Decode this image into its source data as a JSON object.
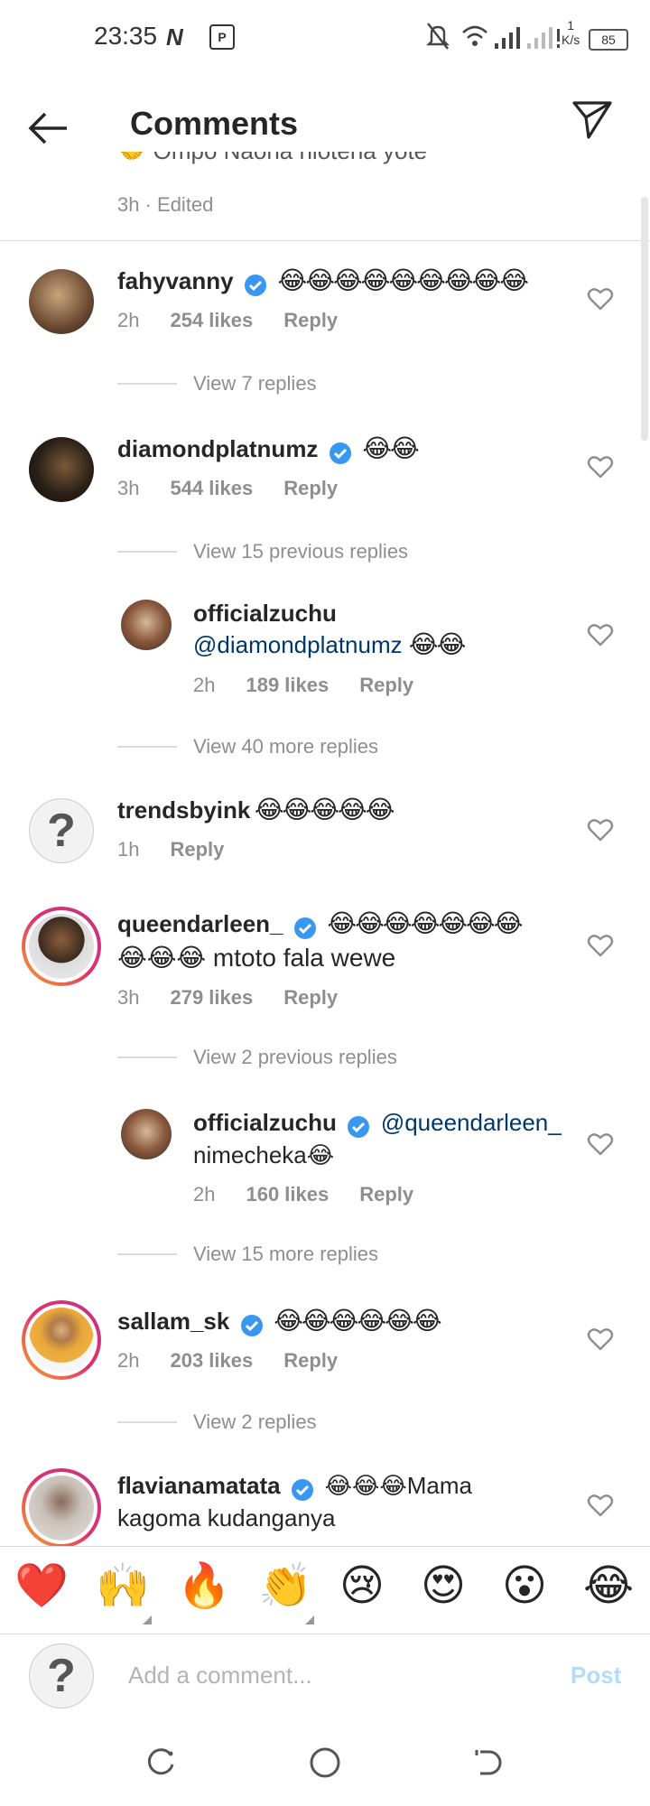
{
  "status_bar": {
    "time": "23:35",
    "n_icon": "N",
    "p_icon": "P",
    "battery": "85",
    "net_speed_top": "1",
    "net_speed_unit": "K/s"
  },
  "header": {
    "title": "Comments",
    "back_icon": "arrow-left-icon",
    "send_icon": "paper-plane-icon"
  },
  "top_partial": {
    "text_fragment": "🤝 Ompo Naona hiotena yote",
    "meta": "3h · Edited"
  },
  "comments": [
    {
      "username": "fahyvanny",
      "text": "😂😂😂😂😂😂😂😂😂",
      "time": "2h",
      "likes": "254 likes",
      "reply": "Reply",
      "view": "View 7 replies"
    },
    {
      "username": "diamondplatnumz",
      "text": "😂😂",
      "time": "3h",
      "likes": "544 likes",
      "reply": "Reply",
      "view": "View 15 previous replies"
    },
    {
      "username": "officialzuchu",
      "mention": "@diamondplatnumz",
      "text": "😂😂",
      "time": "2h",
      "likes": "189 likes",
      "reply": "Reply",
      "view": "View 40 more replies"
    },
    {
      "username": "trendsbyink",
      "text": "😂😂😂😂😂",
      "time": "1h",
      "reply": "Reply"
    },
    {
      "username": "queendarleen_",
      "text": "😂😂😂😂😂😂😂",
      "text2": "😂😂😂 mtoto fala wewe",
      "time": "3h",
      "likes": "279 likes",
      "reply": "Reply",
      "view": "View 2 previous replies"
    },
    {
      "username": "officialzuchu",
      "mention": "@queendarleen_",
      "text": "nimecheka😂",
      "time": "2h",
      "likes": "160 likes",
      "reply": "Reply",
      "view": "View 15 more replies"
    },
    {
      "username": "sallam_sk",
      "text": "😂😂😂😂😂😂",
      "time": "2h",
      "likes": "203 likes",
      "reply": "Reply",
      "view": "View 2 replies"
    },
    {
      "username": "flavianamatata",
      "text": "😂😂😂Mama",
      "text2": "kagoma kudanganya"
    }
  ],
  "reactions": [
    "❤️",
    "🙌",
    "🔥",
    "👏",
    "😢",
    "😍",
    "😮",
    "😂"
  ],
  "compose": {
    "placeholder": "Add a comment...",
    "post": "Post"
  }
}
